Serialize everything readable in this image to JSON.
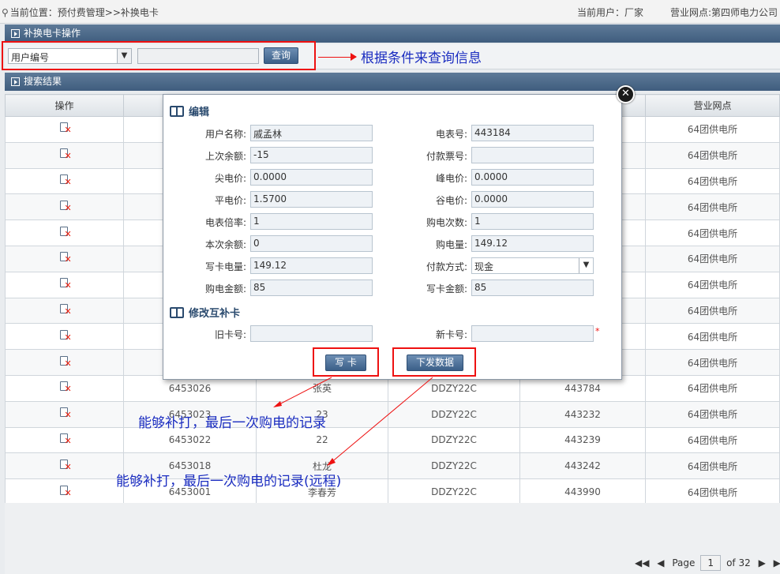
{
  "topbar": {
    "location": "当前位置：预付费管理>>补换电卡",
    "current_user": "当前用户：厂家",
    "branch": "营业网点:第四师电力公司"
  },
  "panel_search": {
    "title": "补换电卡操作"
  },
  "search": {
    "field_value": "用户编号",
    "query_button": "查询",
    "input_value": ""
  },
  "annotations": {
    "search_note": "根据条件来查询信息",
    "write_card_note": "能够补打，最后一次购电的记录",
    "issue_data_note": "能够补打，最后一次购电的记录(远程)"
  },
  "panel_results": {
    "title": "搜索结果"
  },
  "grid": {
    "headers": [
      "操作",
      "",
      "",
      "",
      "",
      "营业网点"
    ],
    "rows": [
      [
        "",
        "",
        "",
        "",
        "64团供电所"
      ],
      [
        "",
        "",
        "",
        "",
        "64团供电所"
      ],
      [
        "",
        "",
        "",
        "",
        "64团供电所"
      ],
      [
        "",
        "",
        "",
        "",
        "64团供电所"
      ],
      [
        "",
        "",
        "",
        "",
        "64团供电所"
      ],
      [
        "",
        "",
        "",
        "",
        "64团供电所"
      ],
      [
        "",
        "",
        "",
        "",
        "64团供电所"
      ],
      [
        "",
        "",
        "",
        "",
        "64团供电所"
      ],
      [
        "",
        "",
        "",
        "",
        "64团供电所"
      ],
      [
        "",
        "",
        "",
        "",
        "64团供电所"
      ],
      [
        "6453026",
        "张英",
        "DDZY22C",
        "443784",
        "64团供电所"
      ],
      [
        "6453023",
        "23",
        "DDZY22C",
        "443232",
        "64团供电所"
      ],
      [
        "6453022",
        "22",
        "DDZY22C",
        "443239",
        "64团供电所"
      ],
      [
        "6453018",
        "杜龙",
        "DDZY22C",
        "443242",
        "64团供电所"
      ],
      [
        "6453001",
        "李春芳",
        "DDZY22C",
        "443990",
        "64团供电所"
      ]
    ]
  },
  "pager": {
    "page_label": "Page",
    "page": "1",
    "of_label": "of 32"
  },
  "modal": {
    "section_edit": "编辑",
    "section_card": "修改互补卡",
    "fields": {
      "user_name_label": "用户名称:",
      "user_name": "戚孟林",
      "meter_no_label": "电表号:",
      "meter_no": "443184",
      "last_balance_label": "上次余额:",
      "last_balance": "-15",
      "receipt_no_label": "付款票号:",
      "receipt_no": "",
      "peak_price_label": "尖电价:",
      "peak_price": "0.0000",
      "high_price_label": "峰电价:",
      "high_price": "0.0000",
      "flat_price_label": "平电价:",
      "flat_price": "1.5700",
      "valley_price_label": "谷电价:",
      "valley_price": "0.0000",
      "meter_ratio_label": "电表倍率:",
      "meter_ratio": "1",
      "buy_count_label": "购电次数:",
      "buy_count": "1",
      "this_balance_label": "本次余额:",
      "this_balance": "0",
      "buy_amount_label": "购电量:",
      "buy_amount": "149.12",
      "write_kwh_label": "写卡电量:",
      "write_kwh": "149.12",
      "pay_method_label": "付款方式:",
      "pay_method": "现金",
      "buy_money_label": "购电金额:",
      "buy_money": "85",
      "write_money_label": "写卡金额:",
      "write_money": "85",
      "old_card_label": "旧卡号:",
      "old_card": "",
      "new_card_label": "新卡号:",
      "new_card": "",
      "required_mark": "*"
    },
    "write_card_button": "写 卡",
    "issue_data_button": "下发数据"
  }
}
